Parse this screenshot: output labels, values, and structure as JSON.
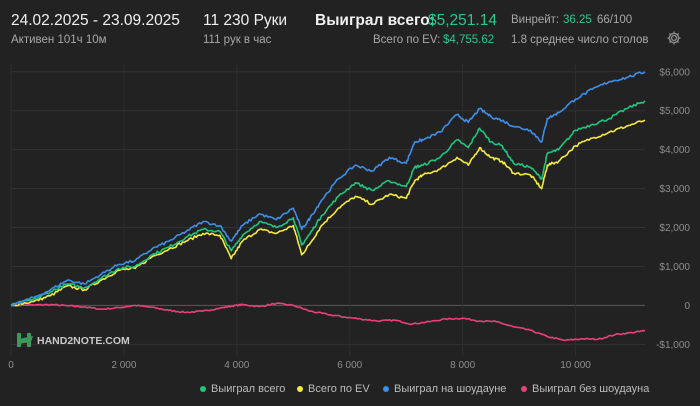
{
  "header": {
    "date_range": "24.02.2025 - 23.09.2025",
    "active": "Активен 101ч 10м",
    "hands": "11 230 Руки",
    "hands_per_hour": "111 рук в час",
    "won_label": "Выиграл всего:",
    "won_value": "$5,251.14",
    "ev_label": "Всего по EV:",
    "ev_value": "$4,755.62",
    "winrate_label": "Винрейт:",
    "winrate_value": "36.25",
    "winrate_score": "66/100",
    "avg_tables": "1.8 среднее число столов",
    "settings_icon": "gear-icon"
  },
  "watermark": {
    "text": "HAND2NOTE.COM",
    "logo_icon": "h2n-logo-icon"
  },
  "colors": {
    "background": "#222222",
    "won": "#1fc47d",
    "ev": "#f4ea3a",
    "showdown": "#3f8ee8",
    "non_showdown": "#e8417a",
    "accent_green": "#27c98f"
  },
  "chart_data": {
    "type": "line",
    "xlim": [
      0,
      11230
    ],
    "ylim": [
      -1300,
      6200
    ],
    "x_ticks": [
      0,
      2000,
      4000,
      6000,
      8000,
      10000
    ],
    "x_tick_labels": [
      "0",
      "2 000",
      "4 000",
      "6 000",
      "8 000",
      "10 000"
    ],
    "y_ticks": [
      6000,
      5000,
      4000,
      3000,
      2000,
      1000,
      0,
      -1000
    ],
    "y_tick_labels": [
      "$6,000",
      "$5,000",
      "$4,000",
      "$3,000",
      "$2,000",
      "$1,000",
      "0",
      "-$1,000"
    ],
    "grid": true,
    "legend_position": "bottom",
    "series": [
      {
        "name": "Выиграл всего",
        "color": "#1fc47d",
        "x": [
          0,
          400,
          700,
          1000,
          1300,
          1600,
          1900,
          2200,
          2500,
          2800,
          3100,
          3400,
          3700,
          3900,
          4100,
          4400,
          4700,
          5000,
          5150,
          5300,
          5500,
          5800,
          6100,
          6400,
          6700,
          7000,
          7150,
          7300,
          7600,
          7900,
          8100,
          8300,
          8500,
          8700,
          8900,
          9200,
          9400,
          9500,
          9700,
          10000,
          10300,
          10600,
          10900,
          11230
        ],
        "y": [
          0,
          150,
          350,
          550,
          450,
          700,
          950,
          1000,
          1300,
          1500,
          1750,
          1950,
          1900,
          1400,
          1800,
          2150,
          2000,
          2250,
          1550,
          1850,
          2300,
          2800,
          3150,
          2950,
          3200,
          3050,
          3550,
          3600,
          3800,
          4250,
          4050,
          4550,
          4200,
          4100,
          3650,
          3550,
          3250,
          3900,
          4000,
          4500,
          4650,
          4800,
          5050,
          5251
        ]
      },
      {
        "name": "Всего по EV",
        "color": "#f4ea3a",
        "x": [
          0,
          400,
          700,
          1000,
          1300,
          1600,
          1900,
          2200,
          2500,
          2800,
          3100,
          3400,
          3700,
          3900,
          4100,
          4400,
          4700,
          5000,
          5150,
          5300,
          5500,
          5800,
          6100,
          6400,
          6700,
          7000,
          7150,
          7300,
          7600,
          7900,
          8100,
          8300,
          8500,
          8700,
          8900,
          9200,
          9400,
          9500,
          9700,
          10000,
          10300,
          10600,
          10900,
          11230
        ],
        "y": [
          0,
          100,
          250,
          500,
          400,
          650,
          900,
          950,
          1250,
          1450,
          1650,
          1850,
          1800,
          1200,
          1650,
          1950,
          1850,
          2050,
          1300,
          1600,
          2050,
          2500,
          2800,
          2600,
          2850,
          2750,
          3200,
          3350,
          3500,
          3800,
          3600,
          4050,
          3800,
          3700,
          3400,
          3350,
          3000,
          3600,
          3700,
          4100,
          4300,
          4450,
          4600,
          4756
        ]
      },
      {
        "name": "Выиграл на шоудауне",
        "color": "#3f8ee8",
        "x": [
          0,
          400,
          700,
          1000,
          1300,
          1600,
          1900,
          2200,
          2500,
          2800,
          3100,
          3400,
          3700,
          3900,
          4100,
          4400,
          4700,
          5000,
          5150,
          5300,
          5500,
          5800,
          6100,
          6400,
          6700,
          7000,
          7150,
          7300,
          7600,
          7900,
          8100,
          8300,
          8500,
          8700,
          8900,
          9200,
          9400,
          9500,
          9700,
          10000,
          10300,
          10600,
          10900,
          11230
        ],
        "y": [
          0,
          200,
          400,
          650,
          550,
          800,
          1050,
          1150,
          1450,
          1650,
          1900,
          2150,
          2050,
          1650,
          2050,
          2350,
          2200,
          2500,
          1950,
          2250,
          2700,
          3250,
          3600,
          3450,
          3800,
          3650,
          4200,
          4250,
          4450,
          4900,
          4700,
          5050,
          4850,
          4750,
          4600,
          4500,
          4200,
          4800,
          4950,
          5300,
          5550,
          5750,
          5850,
          6000
        ]
      },
      {
        "name": "Выиграл без шоудауна",
        "color": "#e8417a",
        "x": [
          0,
          400,
          700,
          1000,
          1300,
          1600,
          1900,
          2200,
          2500,
          2800,
          3100,
          3400,
          3700,
          3900,
          4100,
          4400,
          4700,
          5000,
          5300,
          5600,
          5900,
          6200,
          6500,
          6800,
          7100,
          7400,
          7700,
          8000,
          8300,
          8600,
          8900,
          9200,
          9500,
          9800,
          10100,
          10400,
          10700,
          11000,
          11230
        ],
        "y": [
          0,
          10,
          20,
          -10,
          -40,
          -100,
          -60,
          0,
          -50,
          -130,
          -180,
          -150,
          -70,
          -20,
          20,
          -30,
          50,
          0,
          -150,
          -230,
          -300,
          -350,
          -400,
          -380,
          -480,
          -420,
          -350,
          -330,
          -400,
          -420,
          -550,
          -640,
          -800,
          -900,
          -860,
          -870,
          -750,
          -700,
          -650
        ]
      }
    ]
  }
}
